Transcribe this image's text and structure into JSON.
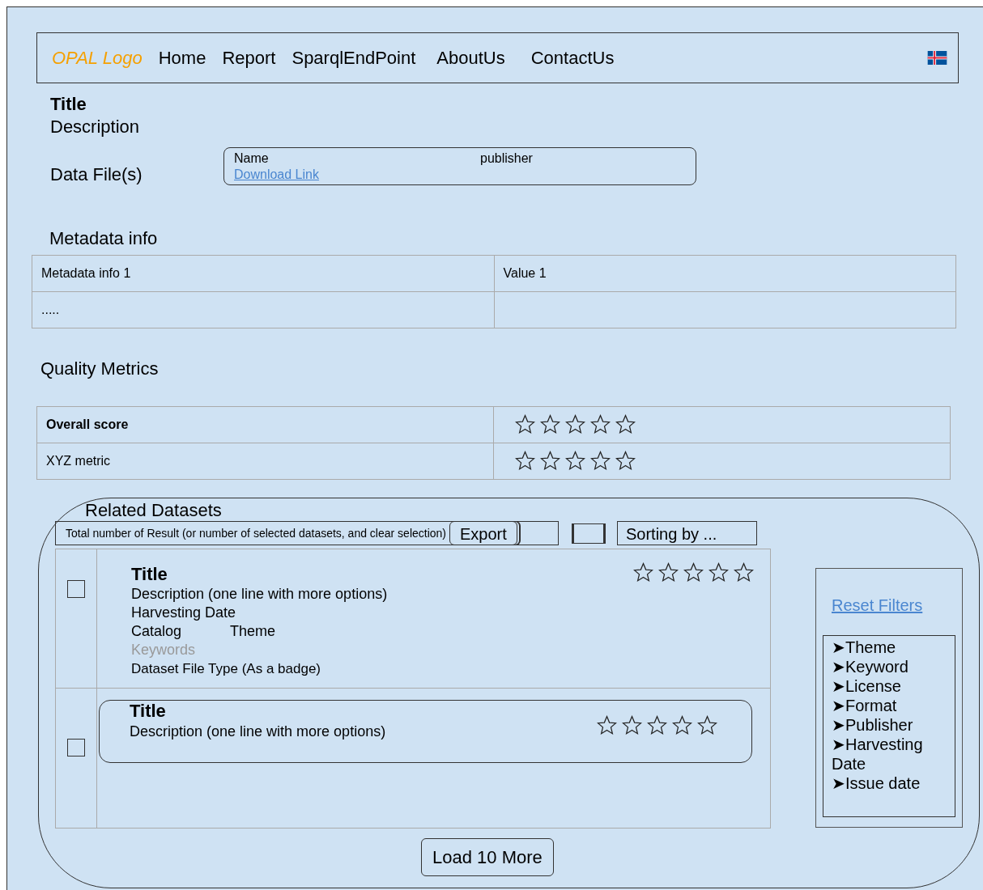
{
  "nav": {
    "logo": "OPAL Logo",
    "links": [
      "Home",
      "Report",
      "SparqlEndPoint",
      "AboutUs",
      "ContactUs"
    ]
  },
  "title": "Title",
  "description": "Description",
  "data_files": {
    "label": "Data File(s)",
    "name": "Name",
    "publisher": "publisher",
    "link": "Download Link"
  },
  "metadata": {
    "heading": "Metadata info",
    "rows": [
      {
        "key": "Metadata info 1",
        "value": "Value 1"
      },
      {
        "key": "....."
      }
    ]
  },
  "quality": {
    "heading": "Quality Metrics",
    "rows": [
      {
        "kind": "total",
        "label": "Overall score",
        "stars": 0
      },
      {
        "kind": "metric",
        "label": "XYZ metric",
        "stars": 0
      }
    ]
  },
  "related": {
    "heading": "Related Datasets",
    "summary": "Total number of Result (or number of selected datasets, and clear selection)",
    "export": "Export",
    "sort": "Sorting by ...",
    "items": [
      {
        "kind": "full",
        "checked": false,
        "title": "Title",
        "description": "Description (one line with more options)",
        "harvesting_date": "Harvesting Date",
        "catalog": "Catalog",
        "theme": "Theme",
        "keywords": "Keywords",
        "file_type": "Dataset File Type (As a badge)",
        "stars": 0
      },
      {
        "kind": "compact",
        "checked": false,
        "title": "Title",
        "description": "Description (one line with more options)",
        "stars": 0
      }
    ],
    "load_more": "Load 10 More",
    "reset": "Reset Filters",
    "filters": [
      "➤Theme",
      "➤Keyword",
      "➤License",
      "➤Format",
      "➤Publisher",
      "➤Harvesting Date",
      "➤Issue date"
    ]
  }
}
